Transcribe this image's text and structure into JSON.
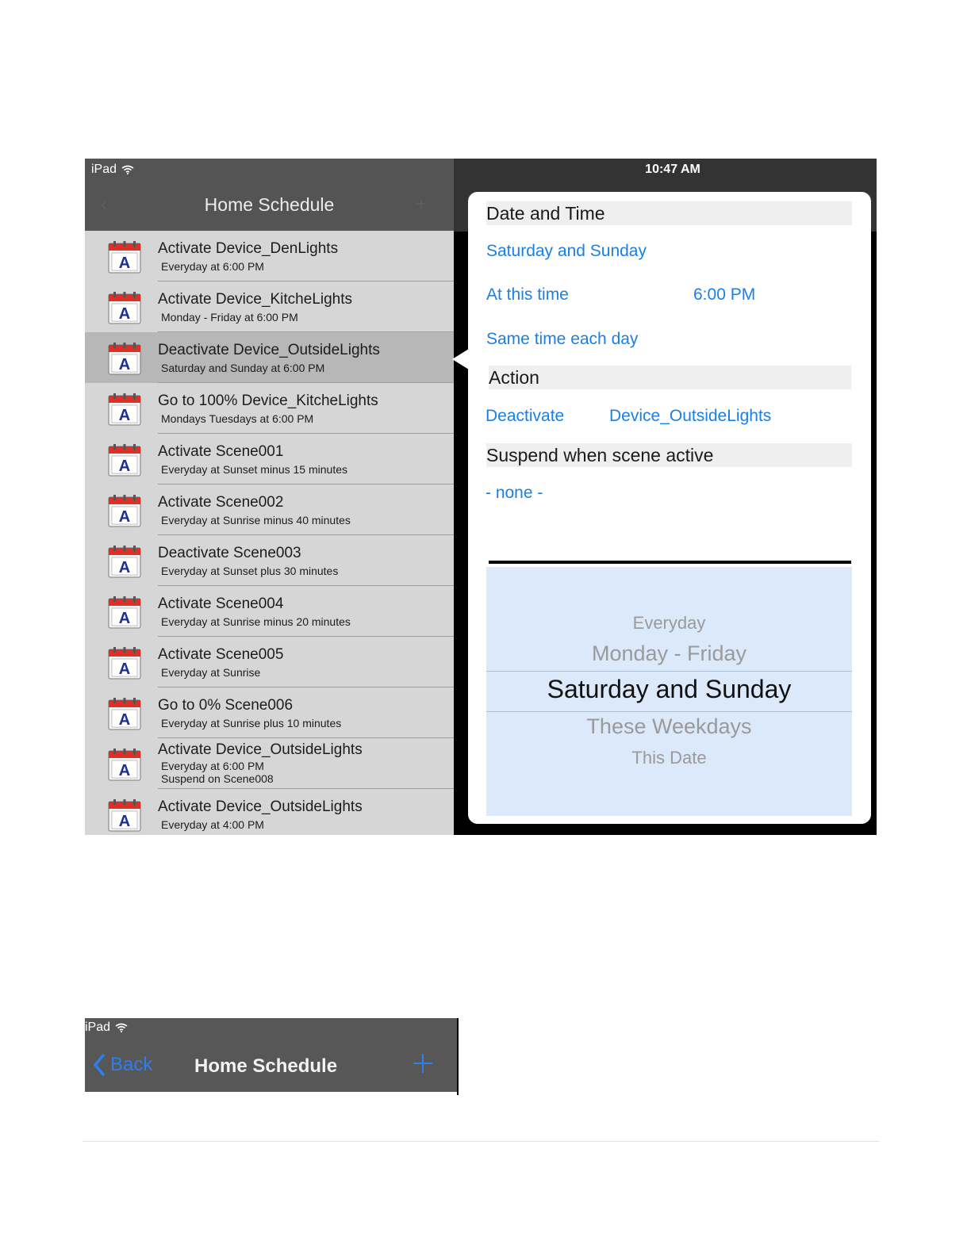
{
  "status": {
    "carrier": "iPad",
    "time": "10:47 AM"
  },
  "nav": {
    "title": "Home Schedule",
    "back_label": "Back",
    "add_label": "+"
  },
  "schedule_items": [
    {
      "title": "Activate Device_DenLights",
      "subtitle": "Everyday at 6:00 PM"
    },
    {
      "title": "Activate Device_KitcheLights",
      "subtitle": "Monday - Friday at 6:00 PM"
    },
    {
      "title": "Deactivate Device_OutsideLights",
      "subtitle": "Saturday and Sunday at 6:00 PM",
      "selected": true
    },
    {
      "title": "Go to 100% Device_KitcheLights",
      "subtitle": "Mondays Tuesdays at 6:00 PM"
    },
    {
      "title": "Activate Scene001",
      "subtitle": "Everyday at Sunset minus 15 minutes"
    },
    {
      "title": "Activate Scene002",
      "subtitle": "Everyday at Sunrise minus 40 minutes"
    },
    {
      "title": "Deactivate Scene003",
      "subtitle": "Everyday at Sunset plus 30 minutes"
    },
    {
      "title": "Activate Scene004",
      "subtitle": "Everyday at Sunrise minus 20 minutes"
    },
    {
      "title": "Activate Scene005",
      "subtitle": "Everyday at Sunrise"
    },
    {
      "title": "Go to 0% Scene006",
      "subtitle": "Everyday at Sunrise plus 10 minutes"
    },
    {
      "title": "Activate Device_OutsideLights",
      "subtitle": "Everyday at 6:00 PM",
      "subtitle2": "Suspend on Scene008"
    },
    {
      "title": "Activate Device_OutsideLights",
      "subtitle": "Everyday at 4:00 PM"
    }
  ],
  "calendar_icon_letter": "A",
  "detail": {
    "date_time_header": "Date and Time",
    "days_value": "Saturday and Sunday",
    "time_label": "At this time",
    "time_value": "6:00 PM",
    "repeat_value": "Same time each day",
    "action_header": "Action",
    "action_value": "Deactivate",
    "target_value": "Device_OutsideLights",
    "suspend_header": "Suspend when scene active",
    "suspend_value": "- none -"
  },
  "picker": {
    "options": [
      "Everyday",
      "Monday - Friday",
      "Saturday and Sunday",
      "These Weekdays",
      "This Date"
    ],
    "selected": "Saturday and Sunday"
  },
  "colors": {
    "link": "#1a7fe6",
    "list_bg": "#d6d6d6",
    "selected_row": "#b7b7b7",
    "nav_bar": "#545454",
    "picker_bg": "#dbe9fb"
  }
}
